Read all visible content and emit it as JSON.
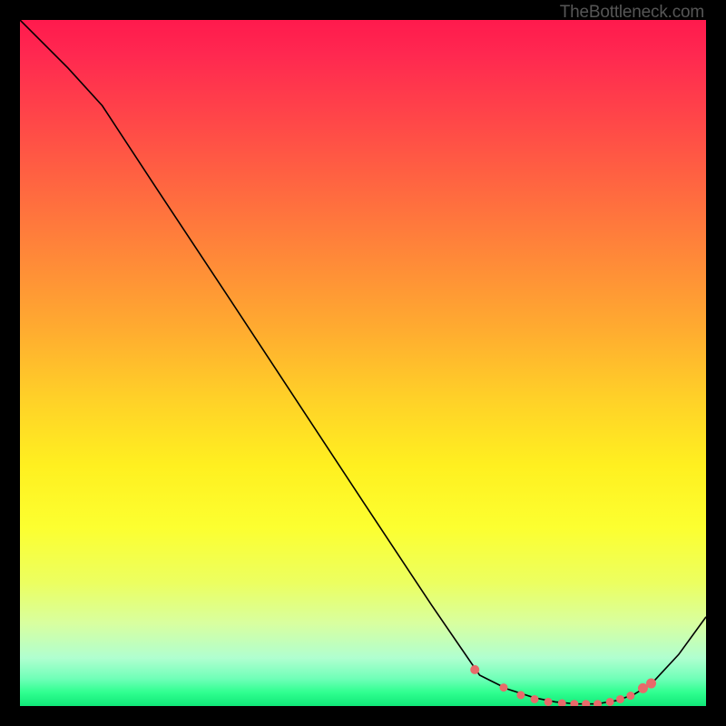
{
  "watermark": "TheBottleneck.com",
  "chart_data": {
    "type": "line",
    "title": "",
    "xlabel": "",
    "ylabel": "",
    "xlim": [
      0,
      100
    ],
    "ylim": [
      0,
      100
    ],
    "series": [
      {
        "name": "curve",
        "x": [
          0,
          7,
          12,
          20,
          30,
          40,
          50,
          60,
          67,
          71,
          75,
          78,
          81,
          84,
          87,
          89.5,
          92,
          96,
          100
        ],
        "values": [
          100,
          93,
          87.5,
          75.3,
          60.2,
          45.0,
          29.8,
          14.7,
          4.5,
          2.5,
          1.2,
          0.6,
          0.3,
          0.3,
          0.8,
          1.7,
          3.2,
          7.5,
          13.0
        ]
      }
    ],
    "markers": {
      "name": "highlight-points",
      "color": "#e86a6a",
      "x": [
        66.3,
        70.5,
        73.0,
        75.0,
        77.0,
        79.0,
        80.8,
        82.5,
        84.2,
        86.0,
        87.5,
        89.0,
        90.8,
        92.0
      ],
      "values": [
        5.3,
        2.7,
        1.6,
        1.0,
        0.6,
        0.4,
        0.3,
        0.3,
        0.3,
        0.6,
        1.0,
        1.5,
        2.6,
        3.3
      ],
      "sizes": [
        5.0,
        4.5,
        4.5,
        4.5,
        4.5,
        4.5,
        4.5,
        4.5,
        4.5,
        4.5,
        4.5,
        4.5,
        5.5,
        5.5
      ]
    }
  }
}
